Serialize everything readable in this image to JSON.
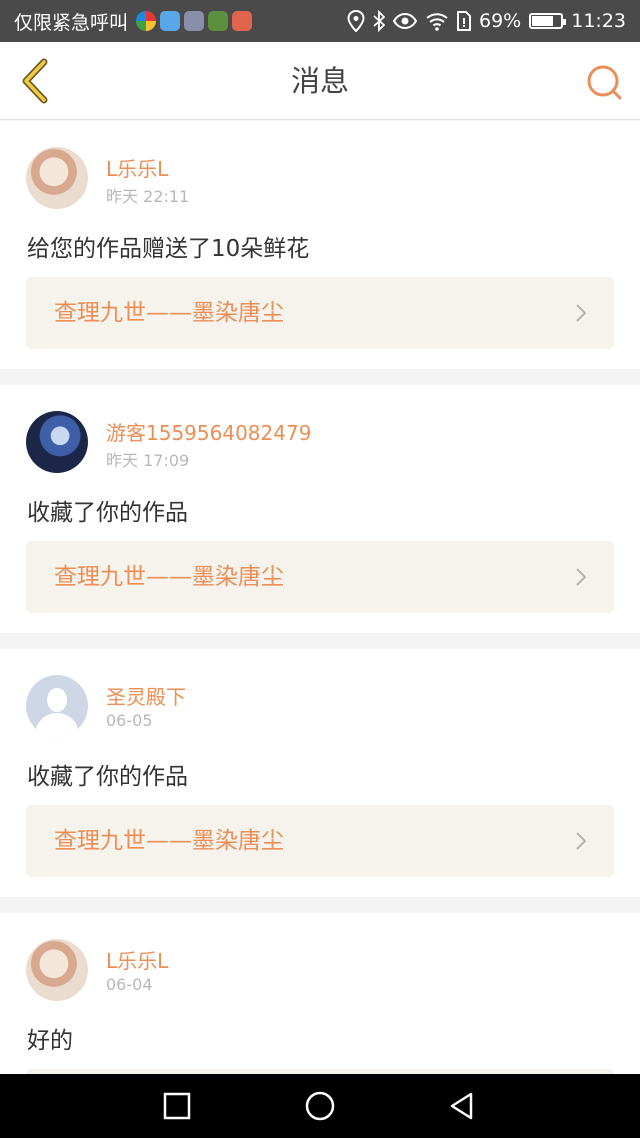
{
  "status_bar": {
    "carrier": "仅限紧急呼叫",
    "battery_text": "69%",
    "battery_level": 0.69,
    "time": "11:23",
    "icons": [
      "location-icon",
      "bluetooth-icon",
      "eye-icon",
      "wifi-icon",
      "sim-icon"
    ]
  },
  "header": {
    "title": "消息",
    "back_icon": "chevron-left-icon",
    "search_icon": "search-icon",
    "accent_color": "#ec8e55"
  },
  "messages": [
    {
      "username": "L乐乐L",
      "time": "昨天 22:11",
      "text": "给您的作品赠送了10朵鲜花",
      "work": "查理九世——墨染唐尘"
    },
    {
      "username": "游客1559564082479",
      "time": "昨天 17:09",
      "text": "收藏了你的作品",
      "work": "查理九世——墨染唐尘"
    },
    {
      "username": "圣灵殿下",
      "time": "06-05",
      "text": "收藏了你的作品",
      "work": "查理九世——墨染唐尘"
    },
    {
      "username": "L乐乐L",
      "time": "06-04",
      "text": "好的",
      "work": ""
    }
  ],
  "nav_bar": {
    "icons": [
      "recents-icon",
      "home-icon",
      "back-icon"
    ]
  }
}
